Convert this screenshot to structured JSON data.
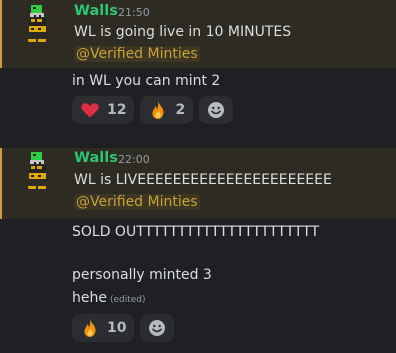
{
  "messages": [
    {
      "author": "Walls",
      "timestamp": "21:50",
      "text": "WL is going live in 10 MINUTES",
      "mention": "@Verified Minties",
      "followups": [
        "in WL you can mint 2"
      ],
      "reactions": [
        {
          "emoji": "heart-icon",
          "count": "12"
        },
        {
          "emoji": "fire-icon",
          "count": "2"
        }
      ]
    },
    {
      "author": "Walls",
      "timestamp": "22:00",
      "text": "WL is LIVEEEEEEEEEEEEEEEEEEEEEE",
      "mention": "@Verified Minties",
      "followups": [
        "SOLD OUTTTTTTTTTTTTTTTTTTTTTT",
        "personally minted 3",
        "hehe"
      ],
      "edited_label": "(edited)",
      "reactions": [
        {
          "emoji": "fire-icon",
          "count": "10"
        }
      ]
    }
  ],
  "colors": {
    "author": "#2dc771",
    "mention": "#c9a13a",
    "background": "#1f2024",
    "reaction_bg": "#2b2d31"
  }
}
